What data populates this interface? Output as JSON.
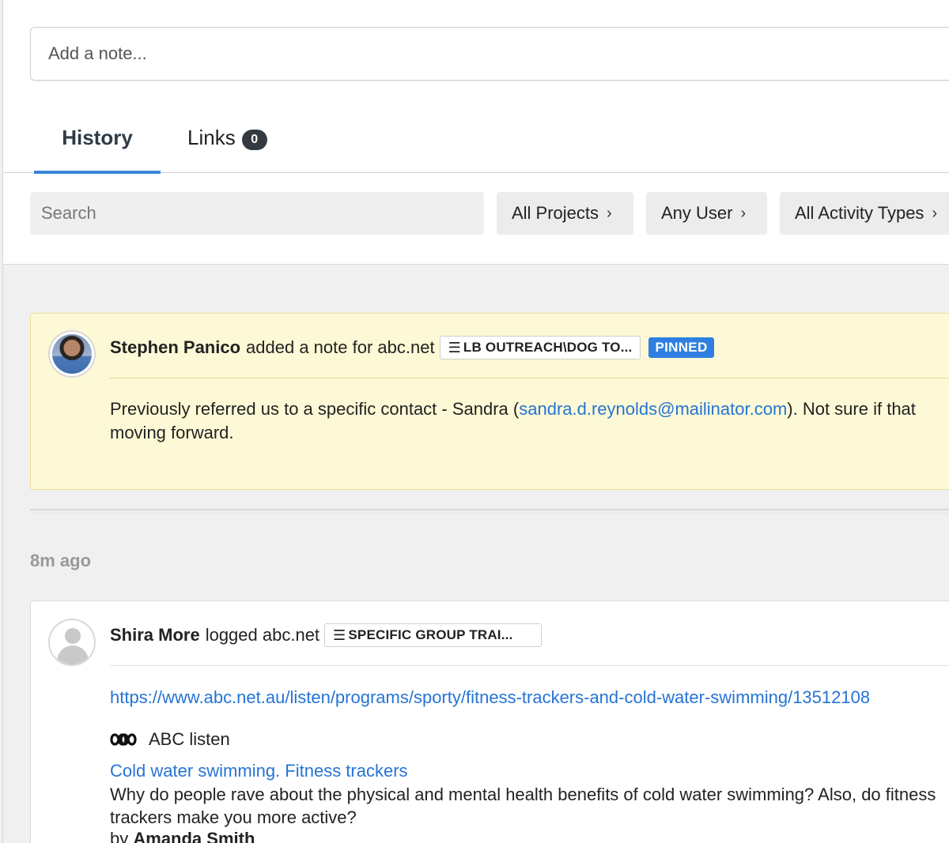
{
  "note_input": {
    "placeholder": "Add a note..."
  },
  "tabs": [
    {
      "label": "History",
      "active": true
    },
    {
      "label": "Links",
      "count": "0"
    }
  ],
  "filters": {
    "search_placeholder": "Search",
    "projects": "All Projects",
    "user": "Any User",
    "activity_types": "All Activity Types"
  },
  "pinned_note": {
    "author": "Stephen Panico",
    "action": "added a note for abc.net",
    "project": "LB OUTREACH\\DOG TO...",
    "badge": "PINNED",
    "text_before": "Previously referred us to a specific contact - Sandra (",
    "email": "sandra.d.reynolds@mailinator.com",
    "text_after": "). Not sure if that",
    "text_line2": "moving forward."
  },
  "time_label": "8m ago",
  "log_entry": {
    "author": "Shira More",
    "action": "logged abc.net",
    "project": "SPECIFIC GROUP TRAI...",
    "url": "https://www.abc.net.au/listen/programs/sporty/fitness-trackers-and-cold-water-swimming/13512108",
    "site_name": "ABC listen",
    "title": "Cold water swimming. Fitness trackers",
    "description": "Why do people rave about the physical and mental health benefits of cold water swimming? Also, do fitness trackers make you more active?",
    "byline_prefix": "by",
    "byline_author": "Amanda Smith"
  },
  "colors": {
    "accent": "#3a86d8",
    "link": "#2574d6",
    "pinned_bg": "#fdf9d6",
    "pinned_badge": "#2f7fe0"
  }
}
